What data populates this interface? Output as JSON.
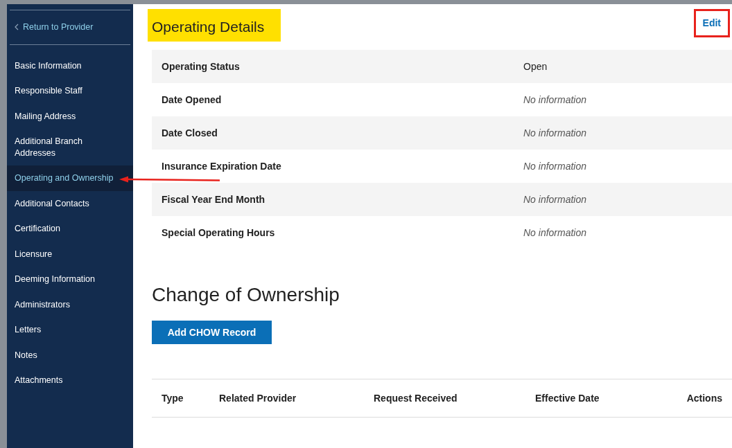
{
  "sidebar": {
    "return_link": "Return to Provider",
    "items": [
      {
        "label": "Basic Information",
        "selected": false
      },
      {
        "label": "Responsible Staff",
        "selected": false
      },
      {
        "label": "Mailing Address",
        "selected": false
      },
      {
        "label": "Additional Branch Addresses",
        "selected": false
      },
      {
        "label": "Operating and Ownership",
        "selected": true
      },
      {
        "label": "Additional Contacts",
        "selected": false
      },
      {
        "label": "Certification",
        "selected": false
      },
      {
        "label": "Licensure",
        "selected": false
      },
      {
        "label": "Deeming Information",
        "selected": false
      },
      {
        "label": "Administrators",
        "selected": false
      },
      {
        "label": "Letters",
        "selected": false
      },
      {
        "label": "Notes",
        "selected": false
      },
      {
        "label": "Attachments",
        "selected": false
      }
    ]
  },
  "operating_details": {
    "title": "Operating Details",
    "edit": "Edit",
    "rows": [
      {
        "label": "Operating Status",
        "value": "Open",
        "missing": false
      },
      {
        "label": "Date Opened",
        "value": "No information",
        "missing": true
      },
      {
        "label": "Date Closed",
        "value": "No information",
        "missing": true
      },
      {
        "label": "Insurance Expiration Date",
        "value": "No information",
        "missing": true
      },
      {
        "label": "Fiscal Year End Month",
        "value": "No information",
        "missing": true
      },
      {
        "label": "Special Operating Hours",
        "value": "No information",
        "missing": true
      }
    ]
  },
  "change_of_ownership": {
    "title": "Change of Ownership",
    "add_button": "Add CHOW Record",
    "table": {
      "columns": [
        "Type",
        "Related Provider",
        "Request Received",
        "Effective Date",
        "Actions"
      ]
    }
  }
}
